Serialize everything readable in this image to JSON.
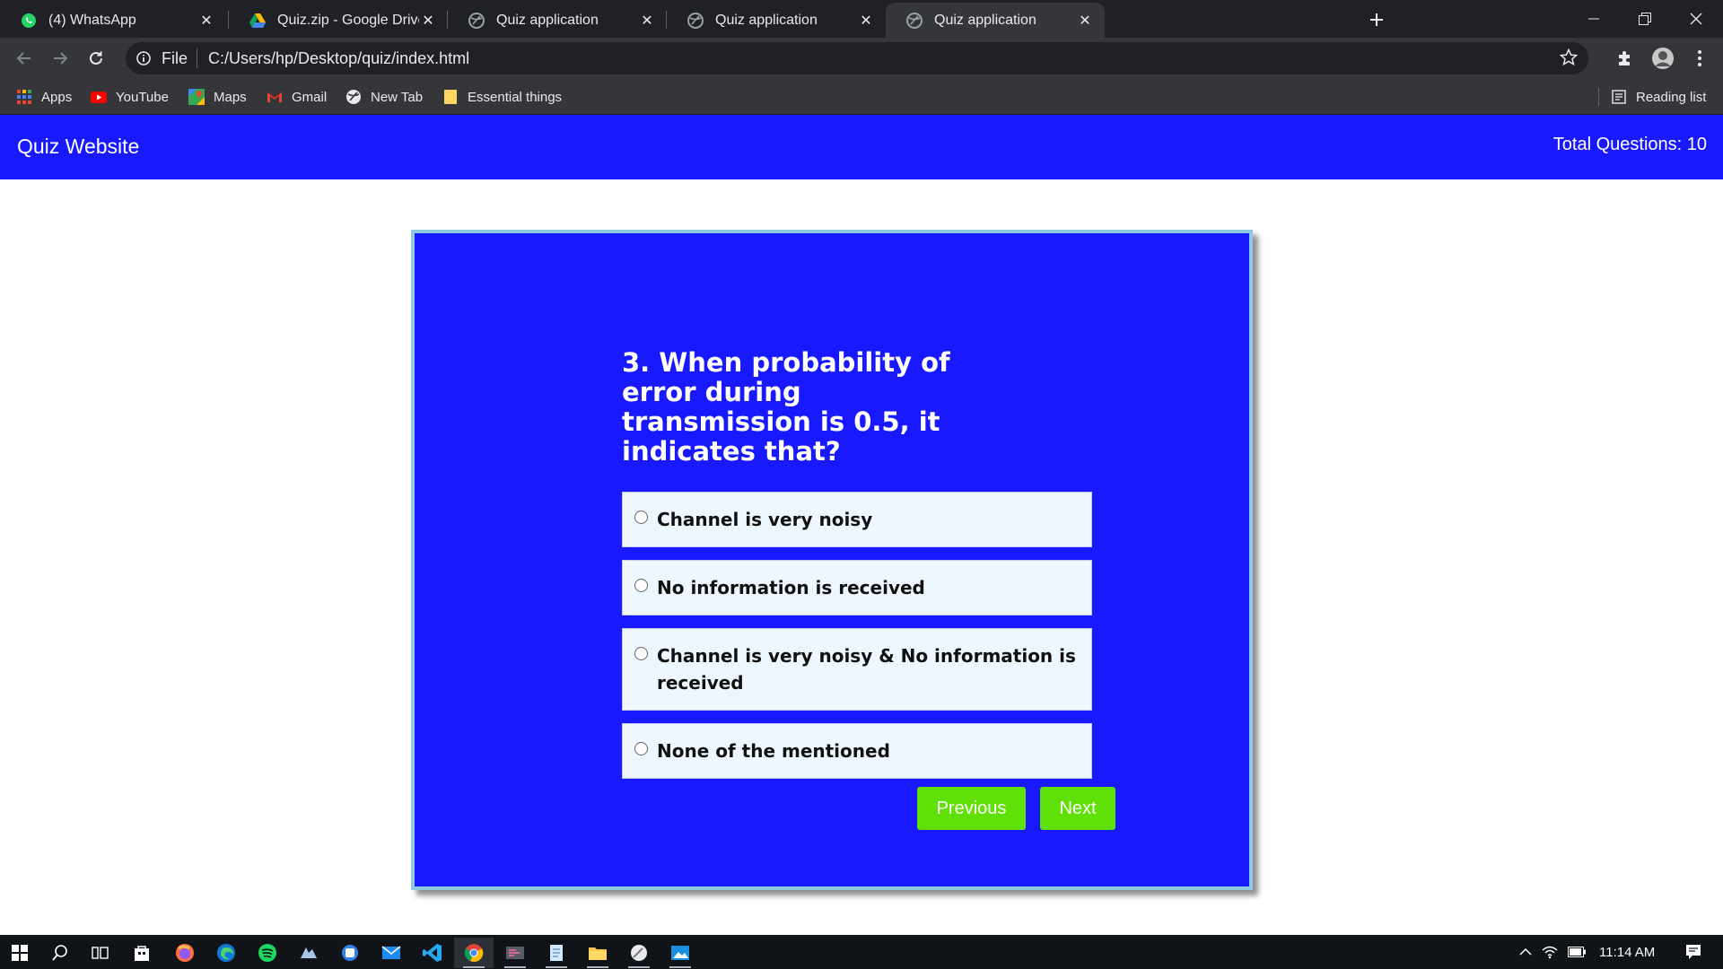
{
  "browser": {
    "tabs": [
      {
        "title": "(4) WhatsApp",
        "icon": "whatsapp-icon",
        "active": false
      },
      {
        "title": "Quiz.zip - Google Drive",
        "icon": "google-drive-icon",
        "active": false
      },
      {
        "title": "Quiz application",
        "icon": "globe-icon",
        "active": false
      },
      {
        "title": "Quiz application",
        "icon": "globe-icon",
        "active": false
      },
      {
        "title": "Quiz application",
        "icon": "globe-icon",
        "active": true
      }
    ],
    "address": {
      "scheme": "File",
      "url": "C:/Users/hp/Desktop/quiz/index.html"
    },
    "bookmarks": [
      {
        "label": "Apps",
        "icon": "apps-grid-icon"
      },
      {
        "label": "YouTube",
        "icon": "youtube-icon"
      },
      {
        "label": "Maps",
        "icon": "maps-icon"
      },
      {
        "label": "Gmail",
        "icon": "gmail-icon"
      },
      {
        "label": "New Tab",
        "icon": "globe-icon"
      },
      {
        "label": "Essential things",
        "icon": "folder-icon"
      }
    ],
    "reading_list": "Reading list"
  },
  "page": {
    "site_title": "Quiz Website",
    "total_questions": "Total Questions: 10",
    "question": "3. When probability of error during transmission is 0.5, it indicates that?",
    "options": [
      "Channel is very noisy",
      "No information is received",
      "Channel is very noisy & No information is received",
      "None of the mentioned"
    ],
    "previous_label": "Previous",
    "next_label": "Next"
  },
  "taskbar": {
    "apps": [
      "windows-start-icon",
      "search-icon",
      "task-view-icon",
      "store-icon",
      "firefox-icon",
      "edge-icon",
      "spotify-icon",
      "app-icon",
      "app-icon",
      "mail-icon",
      "vscode-icon",
      "chrome-icon",
      "app-icon",
      "notepad-icon",
      "file-explorer-icon",
      "app-icon",
      "photos-icon"
    ],
    "time": "11:14 AM"
  },
  "colors": {
    "header_blue": "#1919ff",
    "card_blue": "#1919ff",
    "button_green": "#5fe007",
    "option_bg": "#eef6ff"
  }
}
